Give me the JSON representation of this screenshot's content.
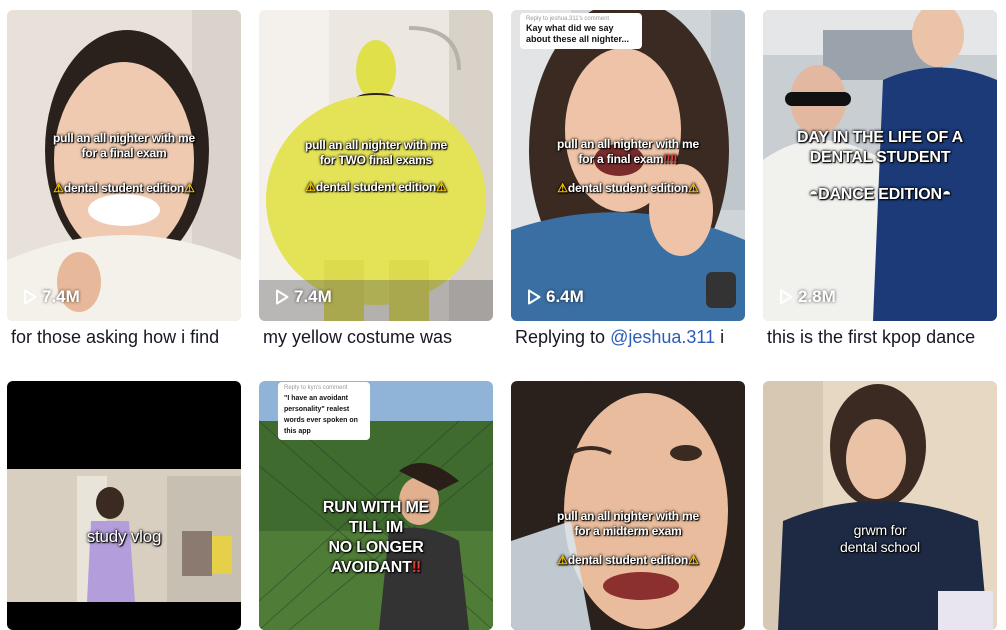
{
  "videos": [
    {
      "overlay_line1": "pull an all nighter with me",
      "overlay_line2": "for a final exam",
      "overlay_line3": "dental student edition",
      "views": "7.4M",
      "description": "for those asking how i find"
    },
    {
      "overlay_line1": "pull an all nighter with me",
      "overlay_line2": "for TWO final exams",
      "overlay_line3": "dental student edition",
      "views": "7.4M",
      "description": "my yellow costume was"
    },
    {
      "reply_title": "Kay what did we say about these all nighter...",
      "overlay_line1": "pull an all nighter with me",
      "overlay_line2": "for a final exam",
      "overlay_line3": "dental student edition",
      "views": "6.4M",
      "description_prefix": "Replying to ",
      "description_mention": "@jeshua.311",
      "description_suffix": " i"
    },
    {
      "overlay_line1": "DAY IN THE LIFE OF A",
      "overlay_line2": "DENTAL STUDENT",
      "overlay_line3": "DANCE EDITION",
      "views": "2.8M",
      "description": "this is the first kpop dance"
    },
    {
      "overlay_line1": "study vlog"
    },
    {
      "reply_title": "\"I have an avoidant personality\" realest words ever spoken on this app",
      "overlay_line1": "RUN WITH ME",
      "overlay_line2": "TILL IM",
      "overlay_line3": "NO LONGER",
      "overlay_line4": "AVOIDANT"
    },
    {
      "overlay_line1": "pull an all nighter with me",
      "overlay_line2": "for a midterm exam",
      "overlay_line3": "dental student edition"
    },
    {
      "overlay_line1": "grwm for",
      "overlay_line2": "dental school"
    }
  ],
  "colors": {
    "mention": "#2b5db9",
    "text": "#161823"
  },
  "icons": {
    "views": "play-outline-icon",
    "warning": "warning-emoji",
    "exclaim": "double-exclamation-emoji",
    "sunglasses": "sunglasses-emoji"
  }
}
